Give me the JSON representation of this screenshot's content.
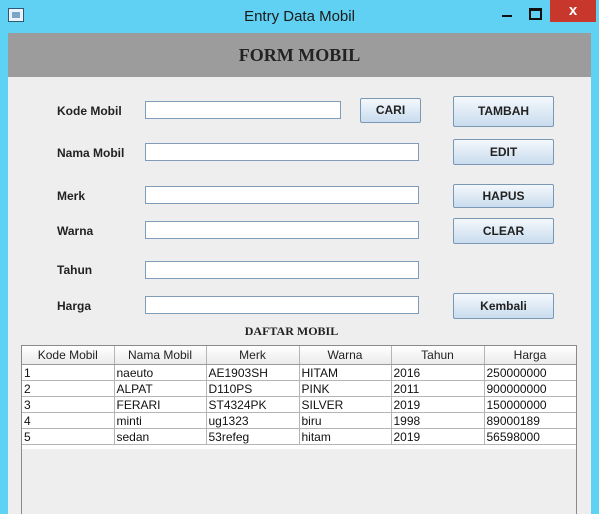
{
  "window": {
    "title": "Entry Data Mobil",
    "close_glyph": "x"
  },
  "header": {
    "title": "FORM MOBIL"
  },
  "form": {
    "kode_label": "Kode Mobil",
    "kode_value": "",
    "nama_label": "Nama Mobil",
    "nama_value": "",
    "merk_label": "Merk",
    "merk_value": "",
    "warna_label": "Warna",
    "warna_value": "",
    "tahun_label": "Tahun",
    "tahun_value": "",
    "harga_label": "Harga",
    "harga_value": ""
  },
  "buttons": {
    "cari": "CARI",
    "tambah": "TAMBAH",
    "edit": "EDIT",
    "hapus": "HAPUS",
    "clear": "CLEAR",
    "kembali": "Kembali"
  },
  "table": {
    "title": "DAFTAR MOBIL",
    "columns": [
      "Kode Mobil",
      "Nama Mobil",
      "Merk",
      "Warna",
      "Tahun",
      "Harga"
    ],
    "rows": [
      [
        "1",
        "naeuto",
        "AE1903SH",
        "HITAM",
        "2016",
        "250000000"
      ],
      [
        "2",
        "ALPAT",
        "D110PS",
        "PINK",
        "2011",
        "900000000"
      ],
      [
        "3",
        "FERARI",
        "ST4324PK",
        "SILVER",
        "2019",
        "150000000"
      ],
      [
        "4",
        "minti",
        "ug1323",
        "biru",
        "1998",
        "89000189"
      ],
      [
        "5",
        "sedan",
        "53refeg",
        "hitam",
        "2019",
        "56598000"
      ]
    ]
  }
}
